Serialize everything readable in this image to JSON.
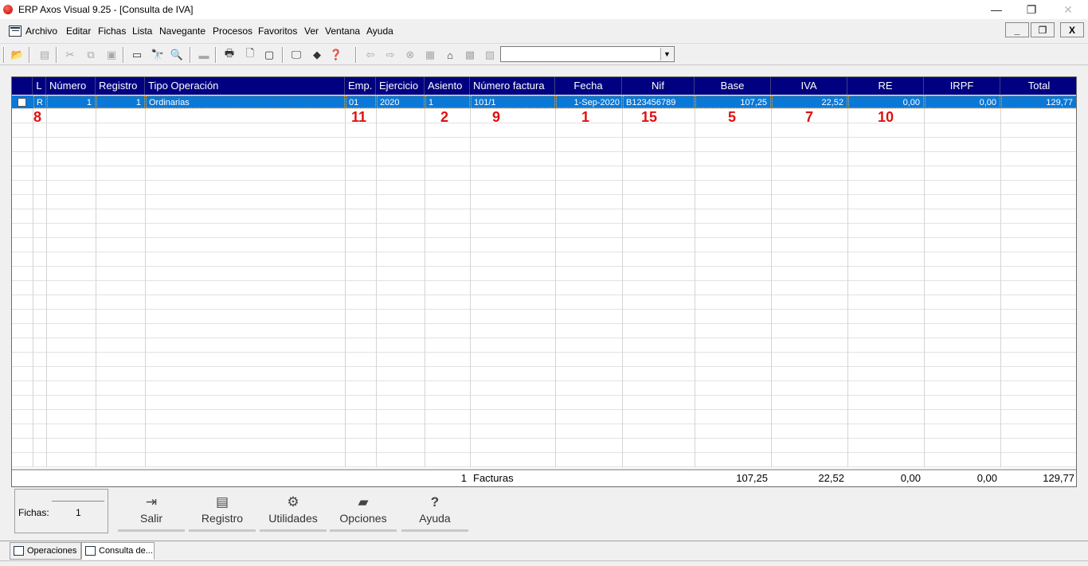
{
  "window": {
    "title": "ERP Axos Visual 9.25 - [Consulta de IVA]",
    "minimize_glyph": "—",
    "restore_glyph": "❐",
    "close_glyph": "✕"
  },
  "menu": {
    "items": [
      {
        "label": "Archivo"
      },
      {
        "label": "Editar"
      },
      {
        "label": "Fichas"
      },
      {
        "label": "Lista"
      },
      {
        "label": "Navegante"
      },
      {
        "label": "Procesos"
      },
      {
        "label": "Favoritos"
      },
      {
        "label": "Ver"
      },
      {
        "label": "Ventana"
      },
      {
        "label": "Ayuda"
      }
    ],
    "mdi_minimize": "_",
    "mdi_restore": "❐",
    "mdi_close": "X"
  },
  "toolbar": {
    "icons": [
      "open-folder-icon",
      "document-icon",
      "cut-icon",
      "copy-icon",
      "paste-icon",
      "window-icon",
      "find-icon",
      "search-icon",
      "stapler-icon",
      "print-icon",
      "print-preview-icon",
      "page-icon",
      "monitor-icon",
      "eraser-icon",
      "help-icon",
      "back-icon",
      "forward-icon",
      "stop-icon",
      "refresh-icon",
      "home-icon",
      "favorites-icon",
      "save-icon"
    ],
    "combo_value": ""
  },
  "grid": {
    "columns": [
      "L",
      "Número",
      "Registro",
      "Tipo Operación",
      "Emp.",
      "Ejercicio",
      "Asiento",
      "Número factura",
      "Fecha",
      "Nif",
      "Base",
      "IVA",
      "RE",
      "IRPF",
      "Total"
    ],
    "rows": [
      {
        "L": "R",
        "numero": "1",
        "registro": "1",
        "tipo": "Ordinarias",
        "emp": "01",
        "ejercicio": "2020",
        "asiento": "1",
        "num_factura": "101/1",
        "fecha": "1-Sep-2020",
        "nif": "B123456789",
        "base": "107,25",
        "iva": "22,52",
        "re": "0,00",
        "irpf": "0,00",
        "total": "129,77"
      }
    ],
    "annotations": {
      "L": "8",
      "emp": "11",
      "asiento": "2",
      "num_factura": "9",
      "fecha": "1",
      "nif": "15",
      "base": "5",
      "iva": "7",
      "re": "10"
    },
    "footer": {
      "count": "1",
      "label": "Facturas",
      "base": "107,25",
      "iva": "22,52",
      "re": "0,00",
      "irpf": "0,00",
      "total": "129,77"
    }
  },
  "bottom": {
    "fichas_label": "Fichas:",
    "fichas_value": "1",
    "buttons": {
      "salir": "Salir",
      "registro": "Registro",
      "utilidades": "Utilidades",
      "opciones": "Opciones",
      "ayuda": "Ayuda"
    }
  },
  "tabs": [
    {
      "label": "Operaciones"
    },
    {
      "label": "Consulta de..."
    }
  ]
}
